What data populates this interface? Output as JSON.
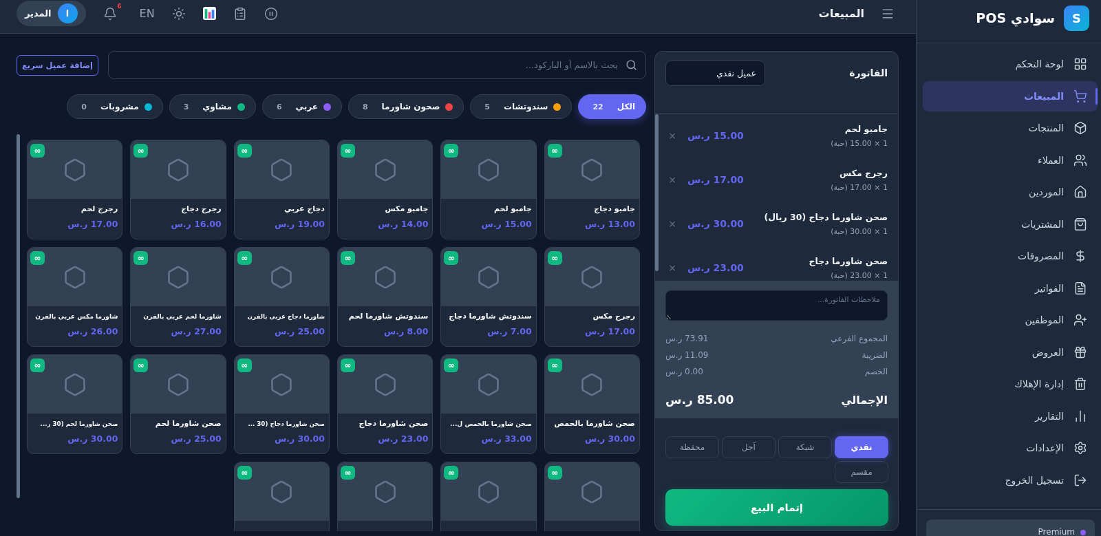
{
  "sidebar": {
    "logo": "S",
    "title": "سوادي POS",
    "items": [
      {
        "label": "لوحة التحكم",
        "selected": false
      },
      {
        "label": "المبيعات",
        "selected": true
      },
      {
        "label": "المنتجات",
        "selected": false
      },
      {
        "label": "العملاء",
        "selected": false
      },
      {
        "label": "الموردين",
        "selected": false
      },
      {
        "label": "المشتريات",
        "selected": false
      },
      {
        "label": "المصروفات",
        "selected": false
      },
      {
        "label": "الفواتير",
        "selected": false
      },
      {
        "label": "الموظفين",
        "selected": false
      },
      {
        "label": "العروض",
        "selected": false
      },
      {
        "label": "إدارة الإهلاك",
        "selected": false
      },
      {
        "label": "التقارير",
        "selected": false
      },
      {
        "label": "الإعدادات",
        "selected": false
      },
      {
        "label": "تسجيل الخروج",
        "selected": false
      }
    ],
    "plan": "Premium"
  },
  "topbar": {
    "title": "المبيعات",
    "language": "EN",
    "notifications": "6",
    "user": {
      "initial": "ا",
      "name": "المدير"
    }
  },
  "search": {
    "placeholder": "بحث بالاسم أو الباركود..."
  },
  "quick_add_button": "إضافة عميل سريع",
  "categories": [
    {
      "name": "الكل",
      "count": "22",
      "selected": true
    },
    {
      "name": "سندوتشات",
      "count": "5",
      "selected": false,
      "color": "#f59e0b"
    },
    {
      "name": "صحون شاورما",
      "count": "8",
      "selected": false,
      "color": "#ef4444"
    },
    {
      "name": "عربي",
      "count": "6",
      "selected": false,
      "color": "#8b5cf6"
    },
    {
      "name": "مشاوي",
      "count": "3",
      "selected": false,
      "color": "#10b981"
    },
    {
      "name": "مشروبات",
      "count": "0",
      "selected": false,
      "color": "#06b6d4"
    }
  ],
  "products": [
    {
      "name": "جامبو دجاج",
      "price": "13.00 ر.س",
      "stock": "∞"
    },
    {
      "name": "جامبو لحم",
      "price": "15.00 ر.س",
      "stock": "∞"
    },
    {
      "name": "جامبو مكس",
      "price": "14.00 ر.س",
      "stock": "∞"
    },
    {
      "name": "دجاج عربي",
      "price": "19.00 ر.س",
      "stock": "∞"
    },
    {
      "name": "رجرج دجاج",
      "price": "16.00 ر.س",
      "stock": "∞"
    },
    {
      "name": "رجرج لحم",
      "price": "17.00 ر.س",
      "stock": "∞"
    },
    {
      "name": "رجرج مكس",
      "price": "17.00 ر.س",
      "stock": "∞"
    },
    {
      "name": "سندوتش شاورما دجاج",
      "price": "7.00 ر.س",
      "stock": "∞"
    },
    {
      "name": "سندوتش شاورما لحم",
      "price": "8.00 ر.س",
      "stock": "∞"
    },
    {
      "name": "شاورما دجاج عربي بالفرن",
      "price": "25.00 ر.س",
      "stock": "∞"
    },
    {
      "name": "شاورما لحم عربي بالفرن",
      "price": "27.00 ر.س",
      "stock": "∞"
    },
    {
      "name": "شاورما مكس عربي بالفرن",
      "price": "26.00 ر.س",
      "stock": "∞"
    },
    {
      "name": "صحن شاورما بالحمص",
      "price": "30.00 ر.س",
      "stock": "∞"
    },
    {
      "name": "صحن شاورما بالحمص ل...",
      "price": "33.00 ر.س",
      "stock": "∞"
    },
    {
      "name": "صحن شاورما دجاج",
      "price": "23.00 ر.س",
      "stock": "∞"
    },
    {
      "name": "صحن شاورما دجاج (30 ...",
      "price": "30.00 ر.س",
      "stock": "∞"
    },
    {
      "name": "صحن شاورما لحم",
      "price": "25.00 ر.س",
      "stock": "∞"
    },
    {
      "name": "صحن شاورما لحم (30 ر...",
      "price": "30.00 ر.س",
      "stock": "∞"
    },
    {
      "stock": "∞"
    },
    {
      "stock": "∞"
    },
    {
      "stock": "∞"
    },
    {
      "stock": "∞"
    }
  ],
  "invoice": {
    "title": "الفاتورة",
    "customer": "عميل نقدي",
    "items": [
      {
        "name": "جامبو لحم",
        "detail": "1 × 15.00 (حبة)",
        "price": "15.00 ر.س",
        "remove": "×"
      },
      {
        "name": "رجرج مكس",
        "detail": "1 × 17.00 (حبة)",
        "price": "17.00 ر.س",
        "remove": "×"
      },
      {
        "name": "صحن شاورما دجاج (30 ريال)",
        "detail": "1 × 30.00 (حبة)",
        "price": "30.00 ر.س",
        "remove": "×"
      },
      {
        "name": "صحن شاورما دجاج",
        "detail": "1 × 23.00 (حبة)",
        "price": "23.00 ر.س",
        "remove": "×"
      }
    ],
    "notes_placeholder": "ملاحظات الفاتورة...",
    "summary": [
      {
        "label": "المجموع الفرعي",
        "value": "73.91 ر.س"
      },
      {
        "label": "الضريبة",
        "value": "11.09 ر.س"
      },
      {
        "label": "الخصم",
        "value": "0.00 ر.س"
      }
    ],
    "total": {
      "label": "الإجمالي",
      "value": "85.00 ر.س"
    },
    "payment_methods": [
      {
        "label": "نقدي",
        "selected": true
      },
      {
        "label": "شبكة",
        "selected": false
      },
      {
        "label": "آجل",
        "selected": false
      },
      {
        "label": "محفظة",
        "selected": false
      },
      {
        "label": "مقسم",
        "selected": false
      }
    ],
    "submit": "إتمام البيع"
  }
}
